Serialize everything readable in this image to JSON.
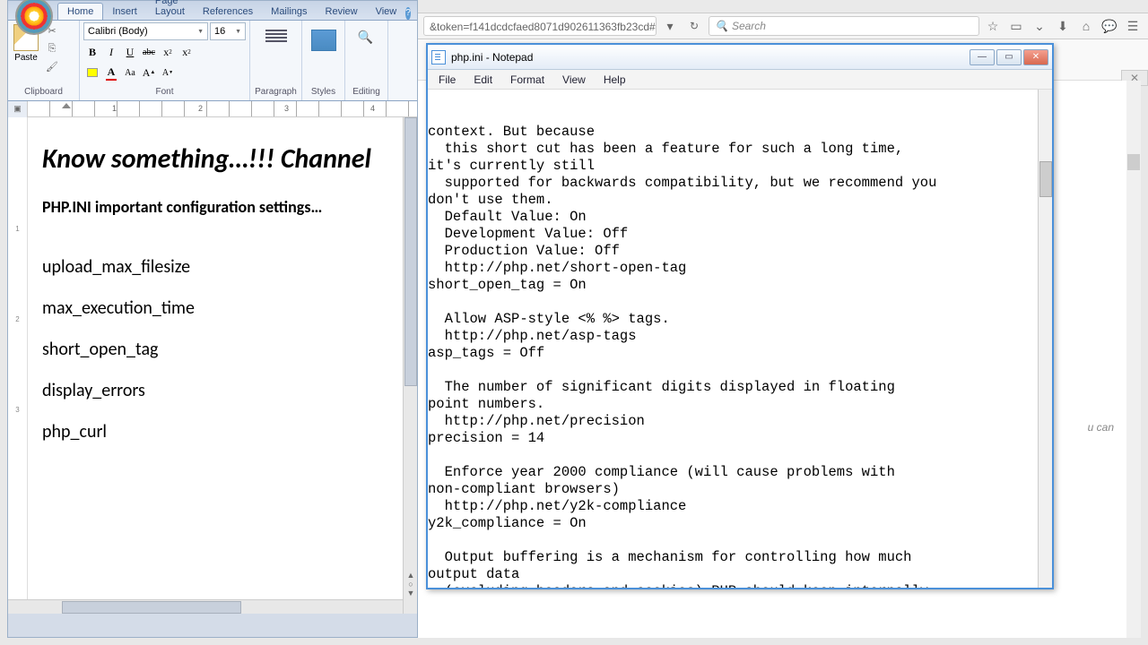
{
  "word": {
    "tabs": [
      "Home",
      "Insert",
      "Page Layout",
      "References",
      "Mailings",
      "Review",
      "View"
    ],
    "active_tab": 0,
    "font_name": "Calibri (Body)",
    "font_size": "16",
    "groups": {
      "clipboard": "Clipboard",
      "paste": "Paste",
      "font": "Font",
      "paragraph": "Paragraph",
      "styles": "Styles",
      "editing": "Editing"
    },
    "doc": {
      "title": "Know something…!!! Channel",
      "subtitle": "PHP.INI important  configuration  settings…",
      "items": [
        "upload_max_filesize",
        "max_execution_time",
        "short_open_tag",
        "display_errors",
        "php_curl"
      ]
    },
    "ruler_nums": [
      "1",
      "2",
      "3",
      "4"
    ],
    "vruler_nums": [
      "1",
      "2",
      "3"
    ]
  },
  "notepad": {
    "title": "php.ini - Notepad",
    "menus": [
      "File",
      "Edit",
      "Format",
      "View",
      "Help"
    ],
    "content": "context. But because\n  this short cut has been a feature for such a long time,\nit's currently still\n  supported for backwards compatibility, but we recommend you\ndon't use them.\n  Default Value: On\n  Development Value: Off\n  Production Value: Off\n  http://php.net/short-open-tag\nshort_open_tag = On\n\n  Allow ASP-style <% %> tags.\n  http://php.net/asp-tags\nasp_tags = Off\n\n  The number of significant digits displayed in floating\npoint numbers.\n  http://php.net/precision\nprecision = 14\n\n  Enforce year 2000 compliance (will cause problems with\nnon-compliant browsers)\n  http://php.net/y2k-compliance\ny2k_compliance = On\n\n  Output buffering is a mechanism for controlling how much\noutput data\n  (excluding headers and cookies) PHP should keep internally"
  },
  "browser": {
    "url": "&token=f141dcdcfaed8071d902611363fb23cd#",
    "search_placeholder": "Search",
    "page_hint": "u can"
  }
}
